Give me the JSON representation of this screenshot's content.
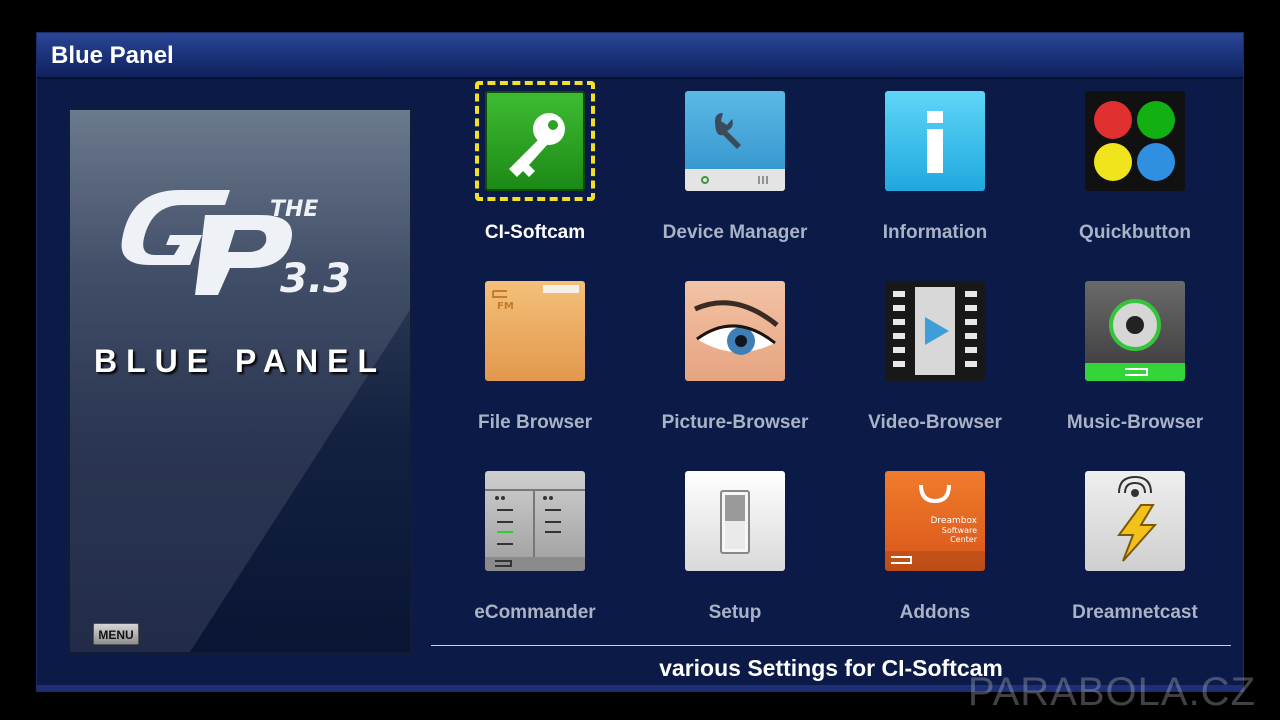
{
  "window": {
    "title": "Blue Panel"
  },
  "logo_panel": {
    "name": "BLUE PANEL",
    "menu_button": "MENU",
    "logo_text_top": "THE",
    "logo_text_version": "3.3"
  },
  "grid": [
    {
      "label": "CI-Softcam",
      "icon": "key-icon",
      "selected": true
    },
    {
      "label": "Device Manager",
      "icon": "wrench-drive-icon",
      "selected": false
    },
    {
      "label": "Information",
      "icon": "info-icon",
      "selected": false
    },
    {
      "label": "Quickbutton",
      "icon": "color-buttons-icon",
      "selected": false
    },
    {
      "label": "File Browser",
      "icon": "folder-icon",
      "selected": false
    },
    {
      "label": "Picture-Browser",
      "icon": "eye-icon",
      "selected": false
    },
    {
      "label": "Video-Browser",
      "icon": "film-icon",
      "selected": false
    },
    {
      "label": "Music-Browser",
      "icon": "speaker-icon",
      "selected": false
    },
    {
      "label": "eCommander",
      "icon": "file-commander-icon",
      "selected": false
    },
    {
      "label": "Setup",
      "icon": "switch-icon",
      "selected": false
    },
    {
      "label": "Addons",
      "icon": "software-center-icon",
      "selected": false,
      "icon_text": [
        "Dreambox",
        "Software",
        "Center"
      ]
    },
    {
      "label": "Dreamnetcast",
      "icon": "netcast-icon",
      "selected": false
    }
  ],
  "footer": {
    "description": "various Settings for CI-Softcam"
  },
  "watermark": "PARABOLA.CZ",
  "colors": {
    "selector": "#f1e02a",
    "title_bar": "#1a3178",
    "background": "#0b1a46"
  }
}
